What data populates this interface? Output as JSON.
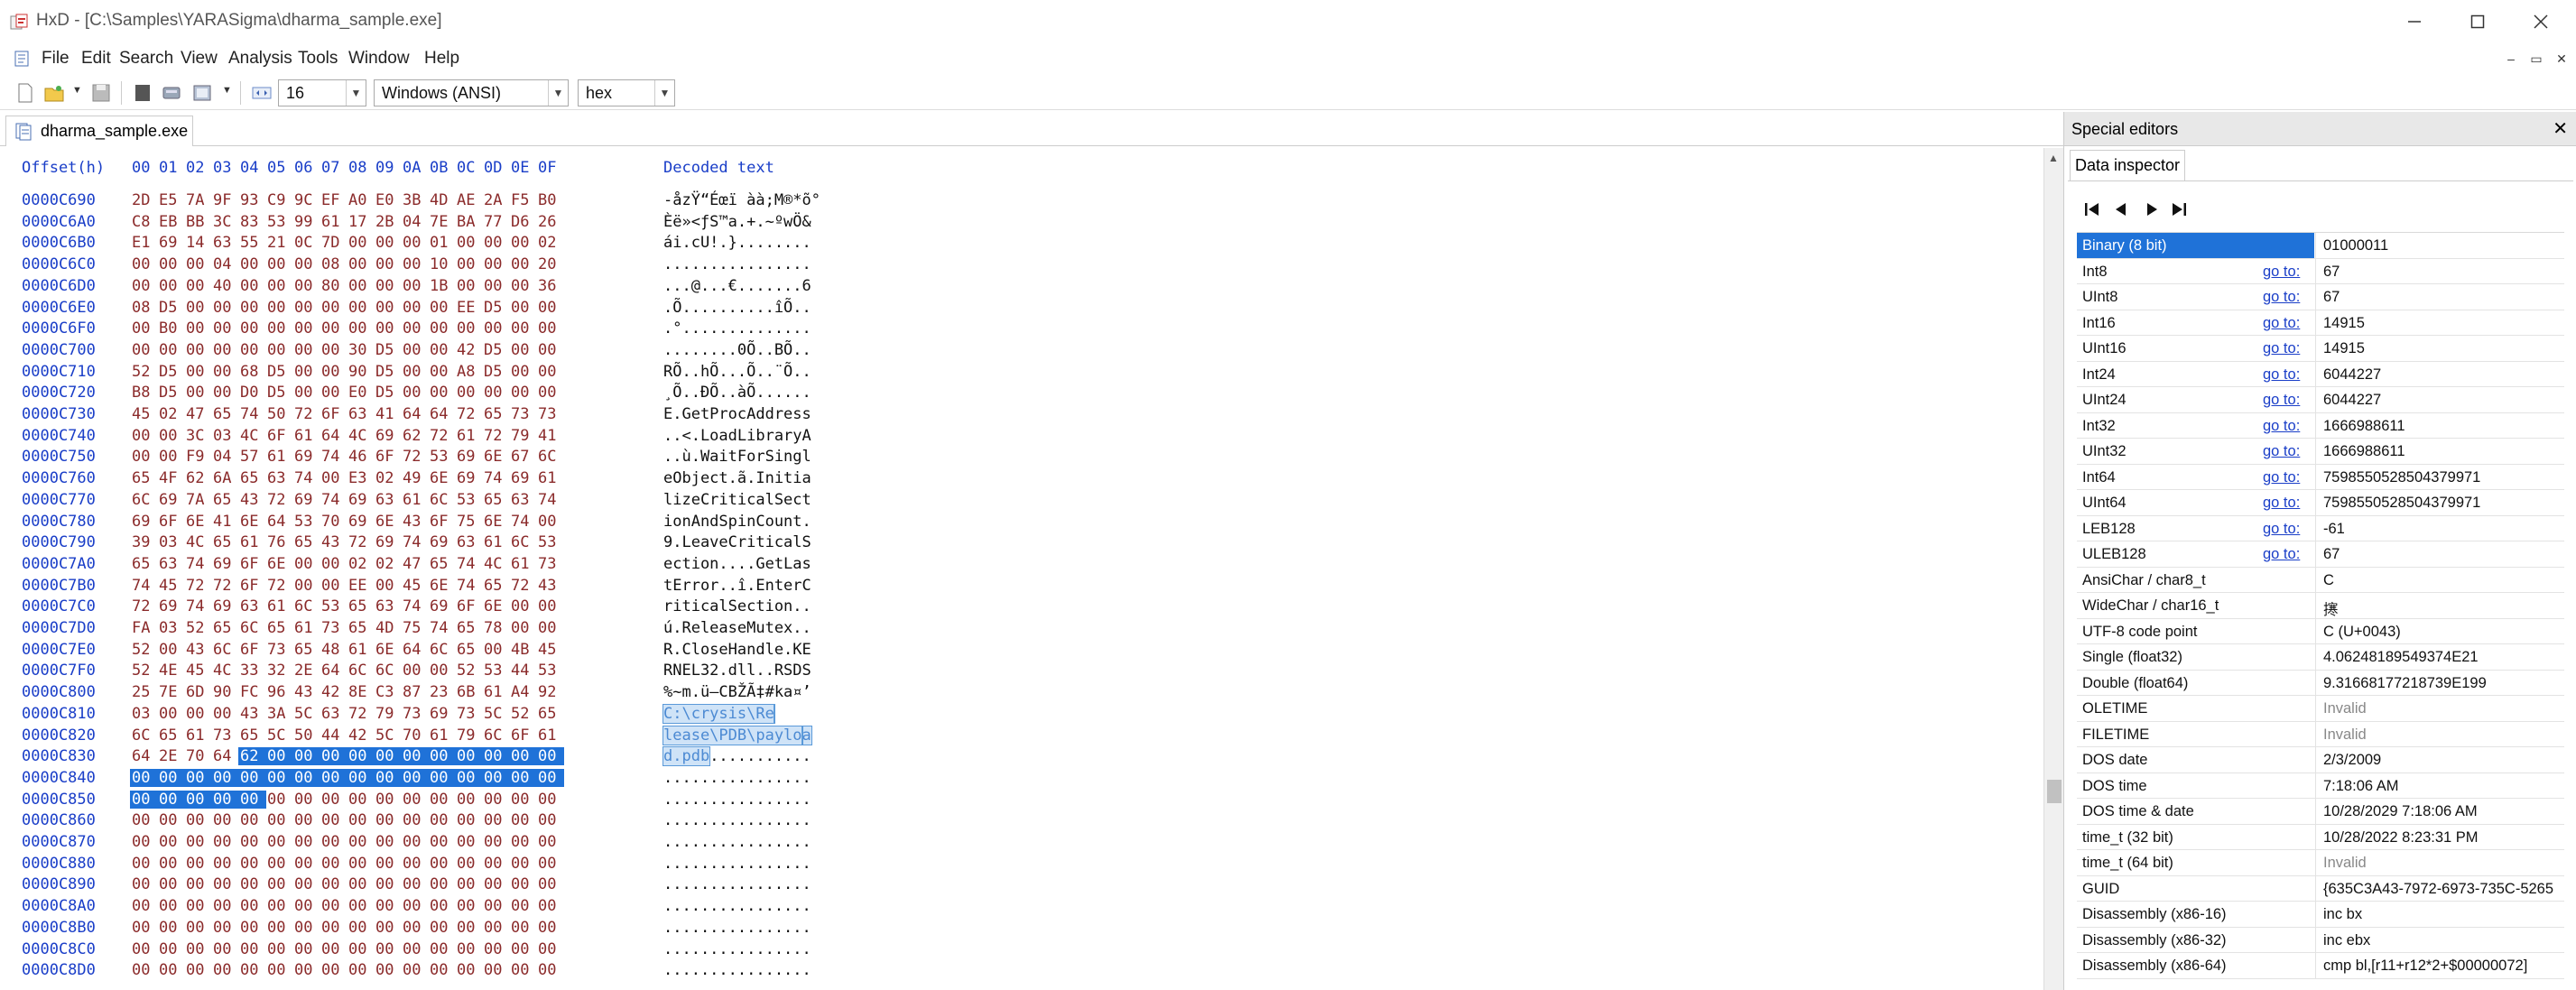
{
  "window": {
    "title": "HxD - [C:\\Samples\\YARASigma\\dharma_sample.exe]",
    "icons": {
      "app": "hxd-app-icon",
      "minimize": "minimize-icon",
      "maximize": "maximize-icon",
      "close": "close-icon"
    }
  },
  "menu": {
    "items": [
      "File",
      "Edit",
      "Search",
      "View",
      "Analysis",
      "Tools",
      "Window",
      "Help"
    ]
  },
  "toolbar": {
    "bytes_per_row": "16",
    "charset": "Windows (ANSI)",
    "display_mode": "hex"
  },
  "document": {
    "tab_label": "dharma_sample.exe"
  },
  "hex": {
    "header_offset": "Offset(h)",
    "header_columns": [
      "00",
      "01",
      "02",
      "03",
      "04",
      "05",
      "06",
      "07",
      "08",
      "09",
      "0A",
      "0B",
      "0C",
      "0D",
      "0E",
      "0F"
    ],
    "header_decoded": "Decoded text",
    "rows": [
      {
        "offset": "0000C690",
        "bytes": [
          "2D",
          "E5",
          "7A",
          "9F",
          "93",
          "C9",
          "9C",
          "EF",
          "A0",
          "E0",
          "3B",
          "4D",
          "AE",
          "2A",
          "F5",
          "B0"
        ],
        "text": "-åzŸ“Éœï àà;M®*õ°"
      },
      {
        "offset": "0000C6A0",
        "bytes": [
          "C8",
          "EB",
          "BB",
          "3C",
          "83",
          "53",
          "99",
          "61",
          "17",
          "2B",
          "04",
          "7E",
          "BA",
          "77",
          "D6",
          "26"
        ],
        "text": "Èë»<ƒS™a.+.~ºwÖ&"
      },
      {
        "offset": "0000C6B0",
        "bytes": [
          "E1",
          "69",
          "14",
          "63",
          "55",
          "21",
          "0C",
          "7D",
          "00",
          "00",
          "00",
          "01",
          "00",
          "00",
          "00",
          "02"
        ],
        "text": "ái.cU!.}........"
      },
      {
        "offset": "0000C6C0",
        "bytes": [
          "00",
          "00",
          "00",
          "04",
          "00",
          "00",
          "00",
          "08",
          "00",
          "00",
          "00",
          "10",
          "00",
          "00",
          "00",
          "20"
        ],
        "text": "................"
      },
      {
        "offset": "0000C6D0",
        "bytes": [
          "00",
          "00",
          "00",
          "40",
          "00",
          "00",
          "00",
          "80",
          "00",
          "00",
          "00",
          "1B",
          "00",
          "00",
          "00",
          "36"
        ],
        "text": "...@...€.......6"
      },
      {
        "offset": "0000C6E0",
        "bytes": [
          "08",
          "D5",
          "00",
          "00",
          "00",
          "00",
          "00",
          "00",
          "00",
          "00",
          "00",
          "00",
          "EE",
          "D5",
          "00",
          "00"
        ],
        "text": ".Õ..........îÕ.."
      },
      {
        "offset": "0000C6F0",
        "bytes": [
          "00",
          "B0",
          "00",
          "00",
          "00",
          "00",
          "00",
          "00",
          "00",
          "00",
          "00",
          "00",
          "00",
          "00",
          "00",
          "00"
        ],
        "text": ".°.............."
      },
      {
        "offset": "0000C700",
        "bytes": [
          "00",
          "00",
          "00",
          "00",
          "00",
          "00",
          "00",
          "00",
          "30",
          "D5",
          "00",
          "00",
          "42",
          "D5",
          "00",
          "00"
        ],
        "text": "........0Õ..BÕ.."
      },
      {
        "offset": "0000C710",
        "bytes": [
          "52",
          "D5",
          "00",
          "00",
          "68",
          "D5",
          "00",
          "00",
          "90",
          "D5",
          "00",
          "00",
          "A8",
          "D5",
          "00",
          "00"
        ],
        "text": "RÕ..hÕ...Õ..¨Õ.."
      },
      {
        "offset": "0000C720",
        "bytes": [
          "B8",
          "D5",
          "00",
          "00",
          "D0",
          "D5",
          "00",
          "00",
          "E0",
          "D5",
          "00",
          "00",
          "00",
          "00",
          "00",
          "00"
        ],
        "text": "¸Õ..ÐÕ..àÕ......"
      },
      {
        "offset": "0000C730",
        "bytes": [
          "45",
          "02",
          "47",
          "65",
          "74",
          "50",
          "72",
          "6F",
          "63",
          "41",
          "64",
          "64",
          "72",
          "65",
          "73",
          "73"
        ],
        "text": "E.GetProcAddress"
      },
      {
        "offset": "0000C740",
        "bytes": [
          "00",
          "00",
          "3C",
          "03",
          "4C",
          "6F",
          "61",
          "64",
          "4C",
          "69",
          "62",
          "72",
          "61",
          "72",
          "79",
          "41"
        ],
        "text": "..<.LoadLibraryA"
      },
      {
        "offset": "0000C750",
        "bytes": [
          "00",
          "00",
          "F9",
          "04",
          "57",
          "61",
          "69",
          "74",
          "46",
          "6F",
          "72",
          "53",
          "69",
          "6E",
          "67",
          "6C"
        ],
        "text": "..ù.WaitForSingl"
      },
      {
        "offset": "0000C760",
        "bytes": [
          "65",
          "4F",
          "62",
          "6A",
          "65",
          "63",
          "74",
          "00",
          "E3",
          "02",
          "49",
          "6E",
          "69",
          "74",
          "69",
          "61"
        ],
        "text": "eObject.ã.Initia"
      },
      {
        "offset": "0000C770",
        "bytes": [
          "6C",
          "69",
          "7A",
          "65",
          "43",
          "72",
          "69",
          "74",
          "69",
          "63",
          "61",
          "6C",
          "53",
          "65",
          "63",
          "74"
        ],
        "text": "lizeCriticalSect"
      },
      {
        "offset": "0000C780",
        "bytes": [
          "69",
          "6F",
          "6E",
          "41",
          "6E",
          "64",
          "53",
          "70",
          "69",
          "6E",
          "43",
          "6F",
          "75",
          "6E",
          "74",
          "00"
        ],
        "text": "ionAndSpinCount."
      },
      {
        "offset": "0000C790",
        "bytes": [
          "39",
          "03",
          "4C",
          "65",
          "61",
          "76",
          "65",
          "43",
          "72",
          "69",
          "74",
          "69",
          "63",
          "61",
          "6C",
          "53"
        ],
        "text": "9.LeaveCriticalS"
      },
      {
        "offset": "0000C7A0",
        "bytes": [
          "65",
          "63",
          "74",
          "69",
          "6F",
          "6E",
          "00",
          "00",
          "02",
          "02",
          "47",
          "65",
          "74",
          "4C",
          "61",
          "73"
        ],
        "text": "ection....GetLas"
      },
      {
        "offset": "0000C7B0",
        "bytes": [
          "74",
          "45",
          "72",
          "72",
          "6F",
          "72",
          "00",
          "00",
          "EE",
          "00",
          "45",
          "6E",
          "74",
          "65",
          "72",
          "43"
        ],
        "text": "tError..î.EnterC"
      },
      {
        "offset": "0000C7C0",
        "bytes": [
          "72",
          "69",
          "74",
          "69",
          "63",
          "61",
          "6C",
          "53",
          "65",
          "63",
          "74",
          "69",
          "6F",
          "6E",
          "00",
          "00"
        ],
        "text": "riticalSection.."
      },
      {
        "offset": "0000C7D0",
        "bytes": [
          "FA",
          "03",
          "52",
          "65",
          "6C",
          "65",
          "61",
          "73",
          "65",
          "4D",
          "75",
          "74",
          "65",
          "78",
          "00",
          "00"
        ],
        "text": "ú.ReleaseMutex.."
      },
      {
        "offset": "0000C7E0",
        "bytes": [
          "52",
          "00",
          "43",
          "6C",
          "6F",
          "73",
          "65",
          "48",
          "61",
          "6E",
          "64",
          "6C",
          "65",
          "00",
          "4B",
          "45"
        ],
        "text": "R.CloseHandle.KE"
      },
      {
        "offset": "0000C7F0",
        "bytes": [
          "52",
          "4E",
          "45",
          "4C",
          "33",
          "32",
          "2E",
          "64",
          "6C",
          "6C",
          "00",
          "00",
          "52",
          "53",
          "44",
          "53"
        ],
        "text": "RNEL32.dll..RSDS"
      },
      {
        "offset": "0000C800",
        "bytes": [
          "25",
          "7E",
          "6D",
          "90",
          "FC",
          "96",
          "43",
          "42",
          "8E",
          "C3",
          "87",
          "23",
          "6B",
          "61",
          "A4",
          "92"
        ],
        "text": "%~m.ü–CBŽÃ‡#ka¤’"
      },
      {
        "offset": "0000C810",
        "bytes": [
          "03",
          "00",
          "00",
          "00",
          "43",
          "3A",
          "5C",
          "63",
          "72",
          "79",
          "73",
          "69",
          "73",
          "5C",
          "52",
          "65"
        ],
        "text": "....",
        "seltext": "C:\\crysis\\Re",
        "selfrom": 4
      },
      {
        "offset": "0000C820",
        "bytes": [
          "6C",
          "65",
          "61",
          "73",
          "65",
          "5C",
          "50",
          "44",
          "42",
          "5C",
          "70",
          "61",
          "79",
          "6C",
          "6F",
          "61"
        ],
        "text": "",
        "seltext": "lease\\PDB\\paylo",
        "selfrom": 0,
        "selto": 16,
        "seltail": "a"
      },
      {
        "offset": "0000C830",
        "bytes": [
          "64",
          "2E",
          "70",
          "64",
          "62",
          "00",
          "00",
          "00",
          "00",
          "00",
          "00",
          "00",
          "00",
          "00",
          "00",
          "00"
        ],
        "text": "...........",
        "seltext": "d.pdb",
        "selfrom": 0,
        "selto": 5,
        "pre": true
      },
      {
        "offset": "0000C840",
        "bytes": [
          "00",
          "00",
          "00",
          "00",
          "00",
          "00",
          "00",
          "00",
          "00",
          "00",
          "00",
          "00",
          "00",
          "00",
          "00",
          "00"
        ],
        "text": "................"
      },
      {
        "offset": "0000C850",
        "bytes": [
          "00",
          "00",
          "00",
          "00",
          "00",
          "00",
          "00",
          "00",
          "00",
          "00",
          "00",
          "00",
          "00",
          "00",
          "00",
          "00"
        ],
        "text": "................"
      },
      {
        "offset": "0000C860",
        "bytes": [
          "00",
          "00",
          "00",
          "00",
          "00",
          "00",
          "00",
          "00",
          "00",
          "00",
          "00",
          "00",
          "00",
          "00",
          "00",
          "00"
        ],
        "text": "................"
      },
      {
        "offset": "0000C870",
        "bytes": [
          "00",
          "00",
          "00",
          "00",
          "00",
          "00",
          "00",
          "00",
          "00",
          "00",
          "00",
          "00",
          "00",
          "00",
          "00",
          "00"
        ],
        "text": "................"
      },
      {
        "offset": "0000C880",
        "bytes": [
          "00",
          "00",
          "00",
          "00",
          "00",
          "00",
          "00",
          "00",
          "00",
          "00",
          "00",
          "00",
          "00",
          "00",
          "00",
          "00"
        ],
        "text": "................"
      },
      {
        "offset": "0000C890",
        "bytes": [
          "00",
          "00",
          "00",
          "00",
          "00",
          "00",
          "00",
          "00",
          "00",
          "00",
          "00",
          "00",
          "00",
          "00",
          "00",
          "00"
        ],
        "text": "................"
      },
      {
        "offset": "0000C8A0",
        "bytes": [
          "00",
          "00",
          "00",
          "00",
          "00",
          "00",
          "00",
          "00",
          "00",
          "00",
          "00",
          "00",
          "00",
          "00",
          "00",
          "00"
        ],
        "text": "................"
      },
      {
        "offset": "0000C8B0",
        "bytes": [
          "00",
          "00",
          "00",
          "00",
          "00",
          "00",
          "00",
          "00",
          "00",
          "00",
          "00",
          "00",
          "00",
          "00",
          "00",
          "00"
        ],
        "text": "................"
      },
      {
        "offset": "0000C8C0",
        "bytes": [
          "00",
          "00",
          "00",
          "00",
          "00",
          "00",
          "00",
          "00",
          "00",
          "00",
          "00",
          "00",
          "00",
          "00",
          "00",
          "00"
        ],
        "text": "................"
      },
      {
        "offset": "0000C8D0",
        "bytes": [
          "00",
          "00",
          "00",
          "00",
          "00",
          "00",
          "00",
          "00",
          "00",
          "00",
          "00",
          "00",
          "00",
          "00",
          "00",
          "00"
        ],
        "text": "................"
      }
    ]
  },
  "special_editors": {
    "title": "Special editors",
    "tab": "Data inspector",
    "goto_label": "go to:",
    "rows": [
      {
        "label": "Binary (8 bit)",
        "value": "01000011",
        "goto": false,
        "active": true
      },
      {
        "label": "Int8",
        "value": "67",
        "goto": true
      },
      {
        "label": "UInt8",
        "value": "67",
        "goto": true
      },
      {
        "label": "Int16",
        "value": "14915",
        "goto": true
      },
      {
        "label": "UInt16",
        "value": "14915",
        "goto": true
      },
      {
        "label": "Int24",
        "value": "6044227",
        "goto": true
      },
      {
        "label": "UInt24",
        "value": "6044227",
        "goto": true
      },
      {
        "label": "Int32",
        "value": "1666988611",
        "goto": true
      },
      {
        "label": "UInt32",
        "value": "1666988611",
        "goto": true
      },
      {
        "label": "Int64",
        "value": "7598550528504379971",
        "goto": true
      },
      {
        "label": "UInt64",
        "value": "7598550528504379971",
        "goto": true
      },
      {
        "label": "LEB128",
        "value": "-61",
        "goto": true
      },
      {
        "label": "ULEB128",
        "value": "67",
        "goto": true
      },
      {
        "label": "AnsiChar / char8_t",
        "value": "C",
        "goto": false
      },
      {
        "label": "WideChar / char16_t",
        "value": "㩃",
        "goto": false
      },
      {
        "label": "UTF-8 code point",
        "value": "C (U+0043)",
        "goto": false
      },
      {
        "label": "Single (float32)",
        "value": "4.06248189549374E21",
        "goto": false
      },
      {
        "label": "Double (float64)",
        "value": "9.31668177218739E199",
        "goto": false
      },
      {
        "label": "OLETIME",
        "value": "Invalid",
        "goto": false,
        "invalid": true
      },
      {
        "label": "FILETIME",
        "value": "Invalid",
        "goto": false,
        "invalid": true
      },
      {
        "label": "DOS date",
        "value": "2/3/2009",
        "goto": false
      },
      {
        "label": "DOS time",
        "value": "7:18:06 AM",
        "goto": false
      },
      {
        "label": "DOS time & date",
        "value": "10/28/2029 7:18:06 AM",
        "goto": false
      },
      {
        "label": "time_t (32 bit)",
        "value": "10/28/2022 8:23:31 PM",
        "goto": false
      },
      {
        "label": "time_t (64 bit)",
        "value": "Invalid",
        "goto": false,
        "invalid": true
      },
      {
        "label": "GUID",
        "value": "{635C3A43-7972-6973-735C-5265",
        "goto": false
      },
      {
        "label": "Disassembly (x86-16)",
        "value": "inc bx",
        "goto": false
      },
      {
        "label": "Disassembly (x86-32)",
        "value": "inc ebx",
        "goto": false
      },
      {
        "label": "Disassembly (x86-64)",
        "value": "cmp bl,[r11+r12*2+$00000072]",
        "goto": false
      }
    ]
  }
}
